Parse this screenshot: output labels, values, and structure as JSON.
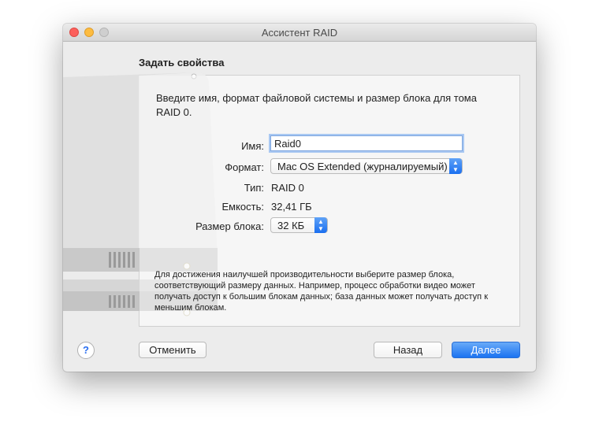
{
  "window": {
    "title": "Ассистент RAID"
  },
  "heading": "Задать свойства",
  "intro": "Введите имя, формат файловой системы и размер блока для тома RAID 0.",
  "fields": {
    "name_label": "Имя:",
    "name_value": "Raid0",
    "format_label": "Формат:",
    "format_value": "Mac OS Extended (журналируемый)",
    "type_label": "Тип:",
    "type_value": "RAID 0",
    "capacity_label": "Емкость:",
    "capacity_value": "32,41 ГБ",
    "block_label": "Размер блока:",
    "block_value": "32 КБ"
  },
  "note": "Для достижения наилучшей производительности выберите размер блока, соответствующий размеру данных. Например, процесс обработки видео может получать доступ к большим блокам данных; база данных может получать доступ к меньшим блокам.",
  "buttons": {
    "help": "?",
    "cancel": "Отменить",
    "back": "Назад",
    "next": "Далее"
  }
}
